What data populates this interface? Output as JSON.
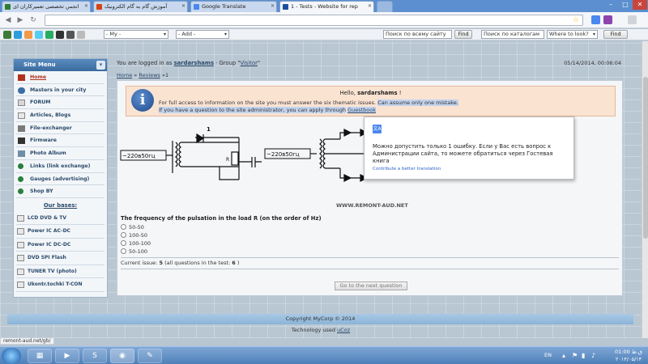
{
  "browser": {
    "tabs": [
      {
        "label": "انجمن تخصصی تعمیرکاران ای",
        "active": false
      },
      {
        "label": "آموزش گام به گام الکترونیک",
        "active": false
      },
      {
        "label": "Google Translate",
        "active": false
      },
      {
        "label": "1 - Tests - Website for rep",
        "active": true
      }
    ],
    "toolbar": {
      "my_select": "- My -",
      "add_select": "- Add -",
      "search_site_value": "Поиск по всему сайту",
      "find1": "Find",
      "search_catalog_value": "Поиск по каталогам",
      "where_select": "Where to look?",
      "find2": "Find"
    },
    "status_url": "remont-aud.net/gb/"
  },
  "sidebar": {
    "title": "Site Menu",
    "items": [
      {
        "label": "Home",
        "active": true
      },
      {
        "label": "Masters in your city",
        "active": false
      },
      {
        "label": "FORUM",
        "active": false
      },
      {
        "label": "Articles, Blogs",
        "active": false
      },
      {
        "label": "File-exchanger",
        "active": false
      },
      {
        "label": "Firmware",
        "active": false
      },
      {
        "label": "Photo Album",
        "active": false
      },
      {
        "label": "Links (link exchange)",
        "active": false
      },
      {
        "label": "Gauges (advertising)",
        "active": false
      },
      {
        "label": "Shop BY",
        "active": false
      }
    ],
    "bases_title": "Our bases:",
    "bases": [
      "LCD DVD & TV",
      "Power IC AC-DC",
      "Power IC DC-DC",
      "DVD SPI Flash",
      "TUNER TV (photo)",
      "Ukontr.tochki T-CON"
    ]
  },
  "header": {
    "logged_in_prefix": "You are logged in as",
    "username": "sardarshams",
    "group_prefix": "· Group \"",
    "group": "Visitor",
    "group_suffix": "\"",
    "datetime": "05/14/2014, 00:06:04"
  },
  "breadcrumb": {
    "home": "Home",
    "sep1": "»",
    "reviews": "Reviews",
    "sep2": "»1"
  },
  "notice": {
    "hello": "Hello,",
    "username": "sardarshams",
    "hello_suffix": "!",
    "line1": "For full access to information on the site you must answer the six thematic issues.",
    "line1_highlight": "Can assume only one mistake.",
    "line2": "If you have a question to the site administrator, you can apply through",
    "line2_link": "Guestbook"
  },
  "circuit": {
    "label_1": "1",
    "src_left": "~220в50гц",
    "res_left": "R",
    "src_right": "~220в50гц",
    "res_right": "R",
    "watermark": "WWW.REMONT-AUD.NET"
  },
  "quiz": {
    "question": "The frequency of the pulsation in the load R (on the order of Hz)",
    "options": [
      "50-50",
      "100-50",
      "100-100",
      "50-100"
    ],
    "current_prefix": "Current issue:",
    "current_num": "5",
    "current_suffix": "(all questions in the test:",
    "total": "6",
    "current_end": ")",
    "next_button": "Go to the next question"
  },
  "footer": {
    "copyright": "Copyright MyCorp © 2014",
    "tech_prefix": "Technology used",
    "tech_link": "uCoz"
  },
  "translate_popup": {
    "icon": "文A",
    "text": "Можно допустить только 1 ошибку. Если у Вас есть вопрос к Администрации сайта, то можете обратиться через Гостевая книга",
    "link": "Contribute a better translation"
  },
  "taskbar": {
    "lang": "EN",
    "time": "01:00 ق.ظ",
    "date": "۲۰۱۴/۰۵/۱۴"
  }
}
